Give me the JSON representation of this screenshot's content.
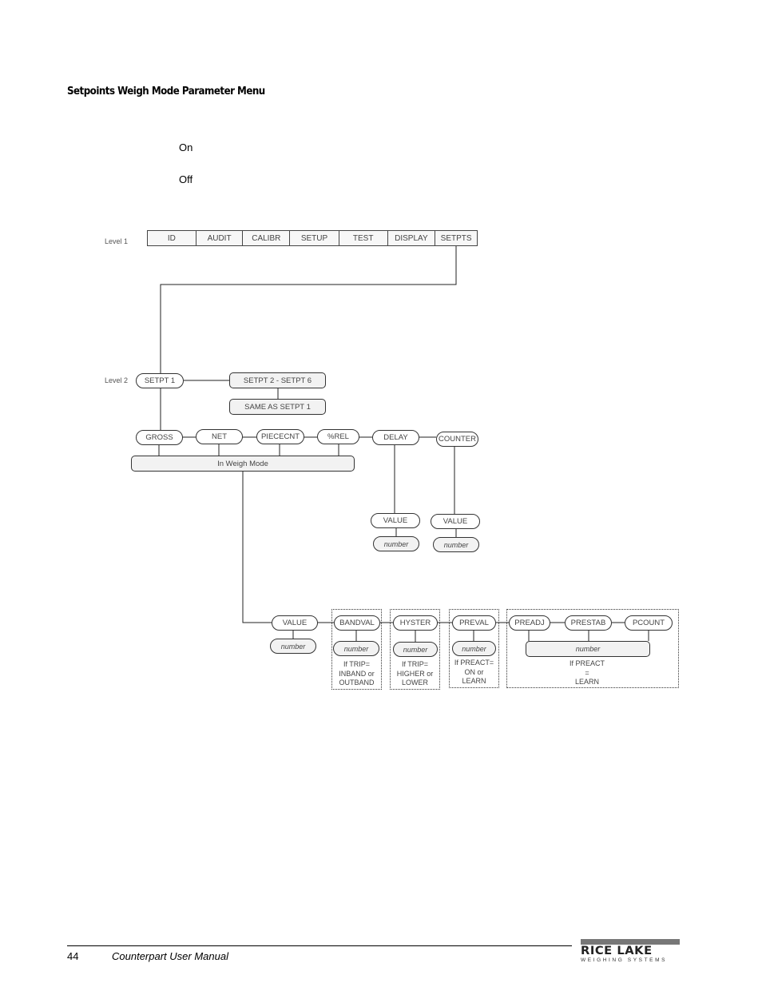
{
  "section_title": "Setpoints Weigh Mode Parameter Menu",
  "options": [
    "On",
    "Off"
  ],
  "diagram": {
    "level1_label": "Level 1",
    "level2_label": "Level 2",
    "level1_items": [
      "ID",
      "AUDIT",
      "CALIBR",
      "SETUP",
      "TEST",
      "DISPLAY",
      "SETPTS"
    ],
    "setpt1": "SETPT 1",
    "setpt2_6": "SETPT 2 - SETPT 6",
    "same_as": "SAME AS SETPT 1",
    "modes": [
      "GROSS",
      "NET",
      "PIECECNT",
      "%REL"
    ],
    "in_weigh_mode": "In Weigh Mode",
    "delay": "DELAY",
    "counter": "COUNTER",
    "delay_value": "VALUE",
    "delay_number": "number",
    "counter_value": "VALUE",
    "counter_number": "number",
    "weigh_value": "VALUE",
    "weigh_number": "number",
    "bandval": "BANDVAL",
    "bandval_number": "number",
    "bandval_note": [
      "If TRIP=",
      "INBAND or",
      "OUTBAND"
    ],
    "hyster": "HYSTER",
    "hyster_number": "number",
    "hyster_note": [
      "If TRIP=",
      "HIGHER or",
      "LOWER"
    ],
    "preval": "PREVAL",
    "preval_number": "number",
    "preval_note": [
      "If PREACT=",
      "ON or",
      "LEARN"
    ],
    "preadj": "PREADJ",
    "prestab": "PRESTAB",
    "pcount": "PCOUNT",
    "learn_number": "number",
    "learn_note": [
      "If PREACT",
      "=",
      "LEARN"
    ]
  },
  "footer": {
    "page_number": "44",
    "manual_title": "Counterpart User Manual",
    "logo_main": "RICE LAKE",
    "logo_sub": "WEIGHING SYSTEMS"
  }
}
